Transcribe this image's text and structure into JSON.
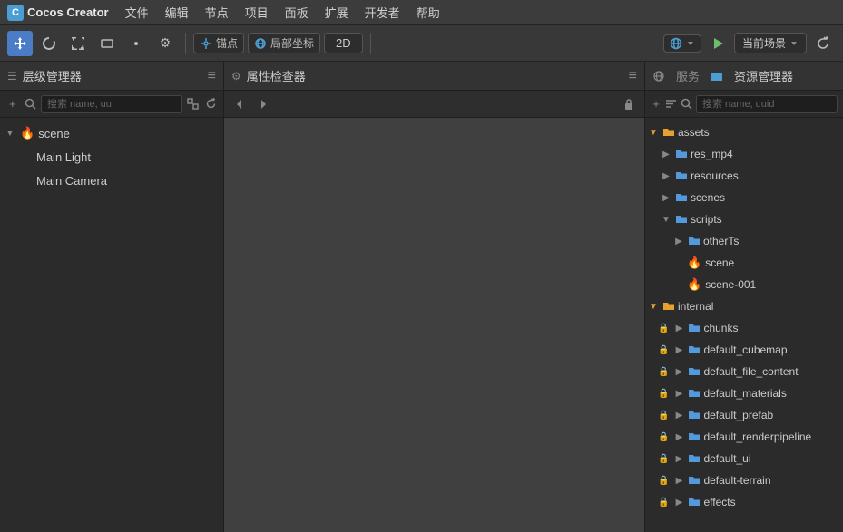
{
  "menubar": {
    "logo_text": "Cocos Creator",
    "items": [
      "文件",
      "编辑",
      "节点",
      "项目",
      "面板",
      "扩展",
      "开发者",
      "帮助"
    ]
  },
  "toolbar": {
    "anchor_label": "锚点",
    "localcoord_label": "局部坐标",
    "2d_label": "2D",
    "scene_label": "当前场景",
    "icons": {
      "move": "✛",
      "rotate": "↻",
      "scale": "⤢",
      "rect": "▭",
      "transform": "⊕",
      "settings": "⚙",
      "globe": "🌐",
      "play": "▶",
      "refresh": "↺"
    }
  },
  "hierarchy": {
    "title": "层级管理器",
    "search_placeholder": "搜索 name, uu",
    "tree": [
      {
        "id": "scene",
        "label": "scene",
        "type": "scene",
        "expanded": true,
        "indent": 0
      },
      {
        "id": "mainlight",
        "label": "Main Light",
        "type": "node",
        "indent": 1
      },
      {
        "id": "maincamera",
        "label": "Main Camera",
        "type": "node",
        "indent": 1
      }
    ]
  },
  "inspector": {
    "title": "属性检查器"
  },
  "services": {
    "tab_label": "服务"
  },
  "assets": {
    "title": "资源管理器",
    "search_placeholder": "搜索 name, uuid",
    "tree": [
      {
        "id": "assets",
        "label": "assets",
        "type": "db-folder",
        "expanded": true,
        "indent": 0,
        "locked": false
      },
      {
        "id": "res_mp4",
        "label": "res_mp4",
        "type": "folder",
        "indent": 1,
        "locked": false
      },
      {
        "id": "resources",
        "label": "resources",
        "type": "folder",
        "indent": 1,
        "locked": false
      },
      {
        "id": "scenes",
        "label": "scenes",
        "type": "folder",
        "indent": 1,
        "locked": false
      },
      {
        "id": "scripts",
        "label": "scripts",
        "type": "folder",
        "expanded": true,
        "indent": 1,
        "locked": false
      },
      {
        "id": "otherTs",
        "label": "otherTs",
        "type": "folder",
        "indent": 2,
        "locked": false
      },
      {
        "id": "scene_file",
        "label": "scene",
        "type": "scene-file",
        "indent": 2,
        "locked": false
      },
      {
        "id": "scene_001",
        "label": "scene-001",
        "type": "scene-file",
        "indent": 2,
        "locked": false
      },
      {
        "id": "internal",
        "label": "internal",
        "type": "db-folder",
        "expanded": true,
        "indent": 0,
        "locked": false
      },
      {
        "id": "chunks",
        "label": "chunks",
        "type": "folder",
        "indent": 1,
        "locked": true
      },
      {
        "id": "default_cubemap",
        "label": "default_cubemap",
        "type": "folder",
        "indent": 1,
        "locked": true
      },
      {
        "id": "default_file_content",
        "label": "default_file_content",
        "type": "folder",
        "indent": 1,
        "locked": true
      },
      {
        "id": "default_materials",
        "label": "default_materials",
        "type": "folder",
        "indent": 1,
        "locked": true
      },
      {
        "id": "default_prefab",
        "label": "default_prefab",
        "type": "folder",
        "indent": 1,
        "locked": true
      },
      {
        "id": "default_renderpipeline",
        "label": "default_renderpipeline",
        "type": "folder",
        "indent": 1,
        "locked": true
      },
      {
        "id": "default_ui",
        "label": "default_ui",
        "type": "folder",
        "indent": 1,
        "locked": true
      },
      {
        "id": "default_terrain",
        "label": "default-terrain",
        "type": "folder",
        "indent": 1,
        "locked": true
      },
      {
        "id": "effects",
        "label": "effects",
        "type": "folder",
        "indent": 1,
        "locked": true
      }
    ]
  }
}
